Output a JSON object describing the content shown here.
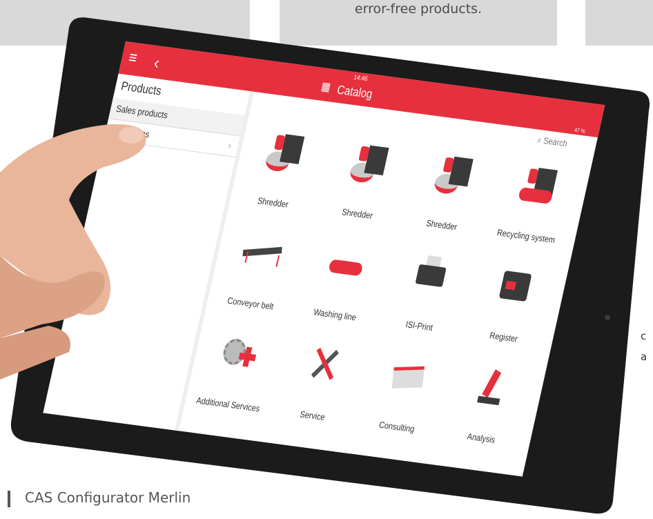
{
  "background": {
    "middle_text": "error-free products.",
    "side_fragment_1": "c",
    "side_fragment_2": "a",
    "caption": "CAS Configurator Merlin"
  },
  "app": {
    "topbar": {
      "time": "14:46",
      "battery": "47 %",
      "title": "Catalog",
      "search_placeholder": "Search"
    },
    "sidebar": {
      "title": "Products",
      "items": [
        {
          "label": "Sales products"
        },
        {
          "label": "odules"
        }
      ]
    },
    "catalog": {
      "items": [
        {
          "label": "Shredder",
          "icon": "shredder-icon"
        },
        {
          "label": "Shredder",
          "icon": "shredder-icon"
        },
        {
          "label": "Shredder",
          "icon": "shredder-icon"
        },
        {
          "label": "Recycling system",
          "icon": "recycling-system-icon"
        },
        {
          "label": "Conveyor belt",
          "icon": "conveyor-belt-icon"
        },
        {
          "label": "Washing line",
          "icon": "washing-line-icon"
        },
        {
          "label": "ISI-Print",
          "icon": "printer-icon"
        },
        {
          "label": "Register",
          "icon": "register-icon"
        },
        {
          "label": "Additional Services",
          "icon": "additional-services-icon"
        },
        {
          "label": "Service",
          "icon": "tools-icon"
        },
        {
          "label": "Consulting",
          "icon": "document-icon"
        },
        {
          "label": "Analysis",
          "icon": "microscope-icon"
        }
      ]
    },
    "colors": {
      "accent": "#e7303d"
    }
  }
}
